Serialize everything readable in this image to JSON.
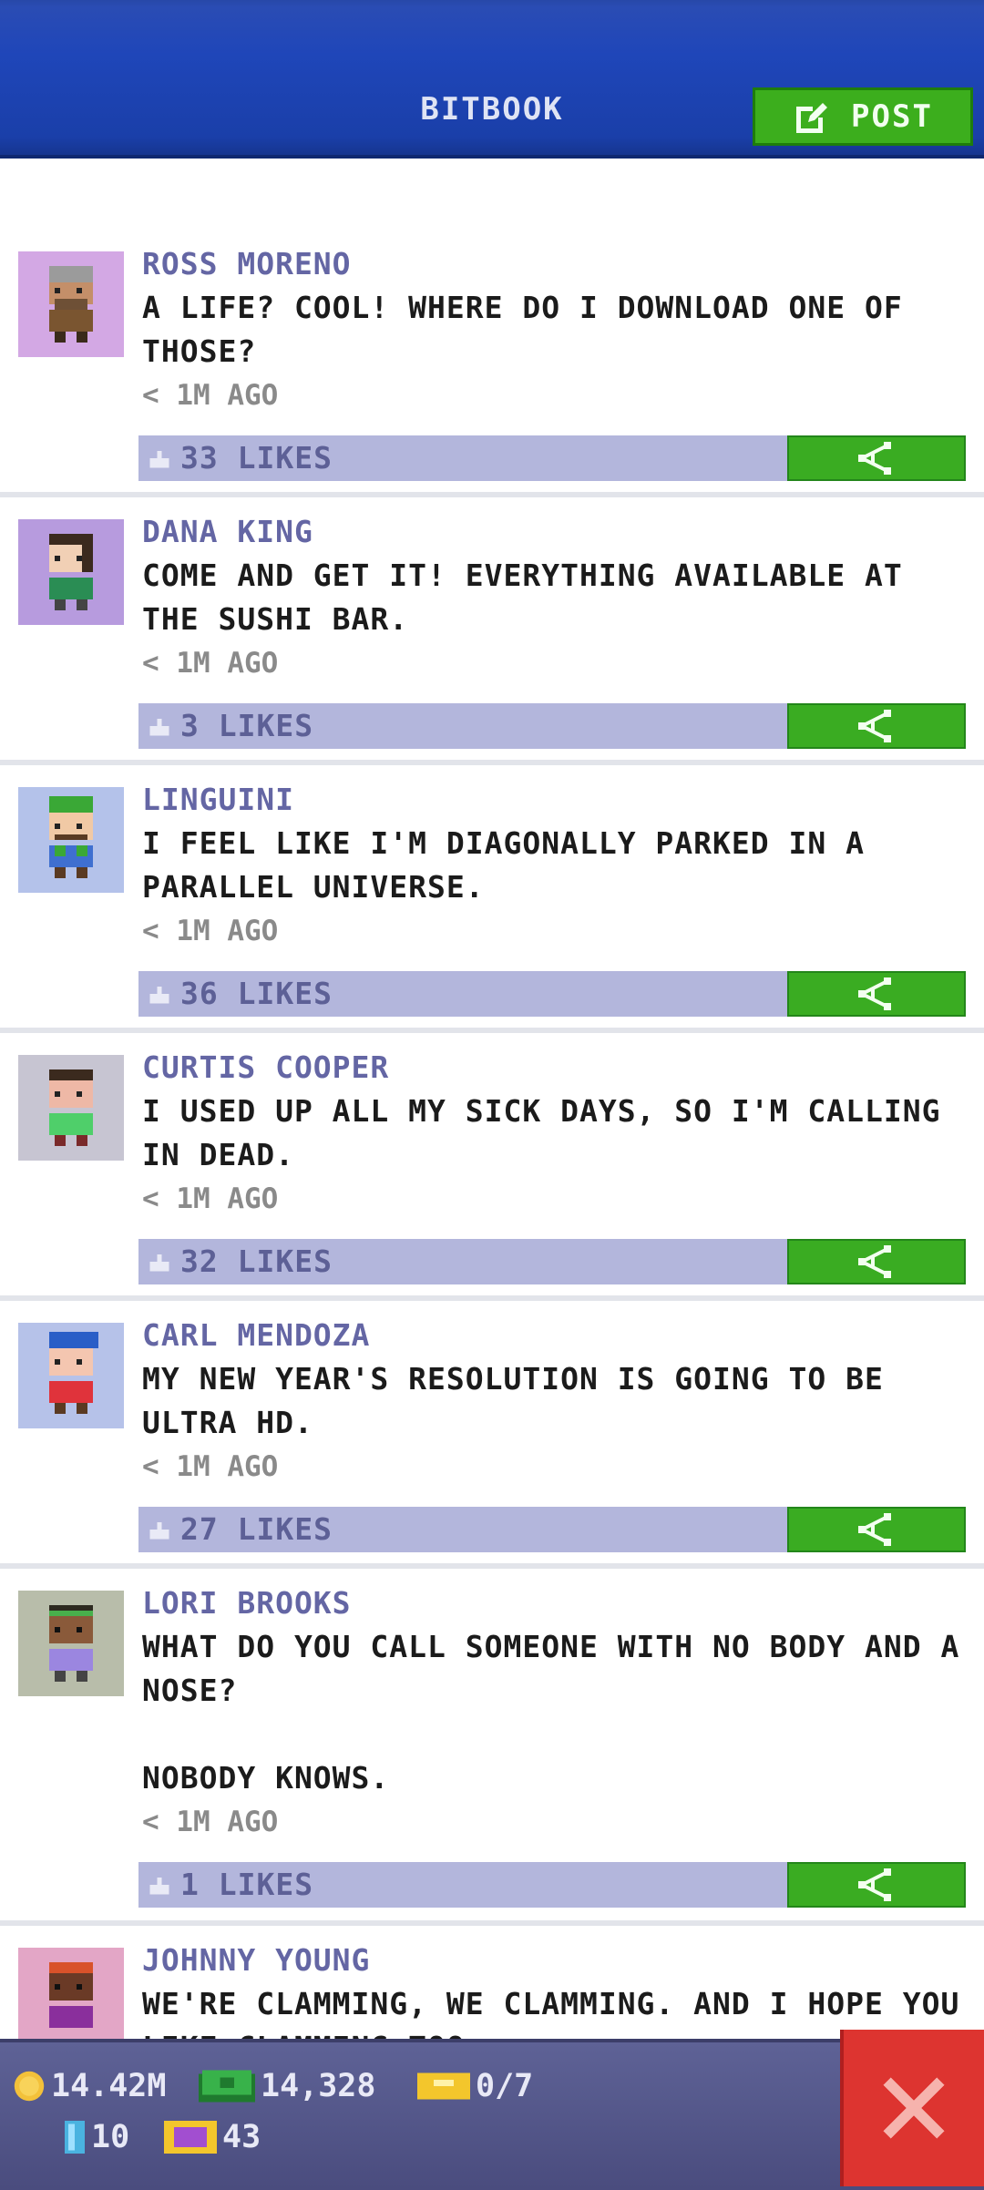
{
  "header": {
    "title": "BITBOOK",
    "post_button": "POST"
  },
  "posts": [
    {
      "author": "ROSS MORENO",
      "message": "A LIFE? COOL! WHERE DO I DOWNLOAD ONE OF THOSE?",
      "time": "< 1M AGO",
      "likes": "33 LIKES",
      "avatar_bg": "#d3a8e4"
    },
    {
      "author": "DANA KING",
      "message": "COME AND GET IT! EVERYTHING AVAILABLE AT THE SUSHI BAR.",
      "time": "< 1M AGO",
      "likes": "3 LIKES",
      "avatar_bg": "#b79bde"
    },
    {
      "author": "LINGUINI",
      "message": "I FEEL LIKE I'M DIAGONALLY PARKED IN A PARALLEL UNIVERSE.",
      "time": "< 1M AGO",
      "likes": "36 LIKES",
      "avatar_bg": "#b4c2ea"
    },
    {
      "author": "CURTIS COOPER",
      "message": "I USED UP ALL MY SICK DAYS, SO I'M CALLING IN DEAD.",
      "time": "< 1M AGO",
      "likes": "32 LIKES",
      "avatar_bg": "#c7c5d2"
    },
    {
      "author": "CARL MENDOZA",
      "message": "MY NEW YEAR'S RESOLUTION IS GOING TO BE ULTRA HD.",
      "time": "< 1M AGO",
      "likes": "27 LIKES",
      "avatar_bg": "#b6c2e9"
    },
    {
      "author": "LORI BROOKS",
      "message": "WHAT DO YOU CALL SOMEONE WITH NO BODY AND A NOSE?\n\nNOBODY KNOWS.",
      "time": "< 1M AGO",
      "likes": "1 LIKES",
      "avatar_bg": "#b8bdaa"
    },
    {
      "author": "JOHNNY YOUNG",
      "message": "WE'RE CLAMMING, WE CLAMMING. AND I HOPE YOU LIKE CLAMMING TOO.",
      "time": "",
      "likes": "",
      "avatar_bg": "#e3a6c6"
    }
  ],
  "status": {
    "coins": "14.42M",
    "bux": "14,328",
    "tickets": "0/7",
    "tokens": "10",
    "vip": "43"
  },
  "colors": {
    "header_blue": "#1f46b9",
    "green_button": "#3aac22",
    "likes_bar": "#b3b6dc",
    "close_red": "#dd3430"
  },
  "icons": {
    "post": "edit-icon",
    "share": "share-icon",
    "like": "thumbs-up-icon",
    "close": "close-icon",
    "coin": "coin-icon",
    "bux": "bux-icon",
    "ticket": "ticket-icon",
    "token": "token-icon",
    "vip": "vip-icon"
  }
}
